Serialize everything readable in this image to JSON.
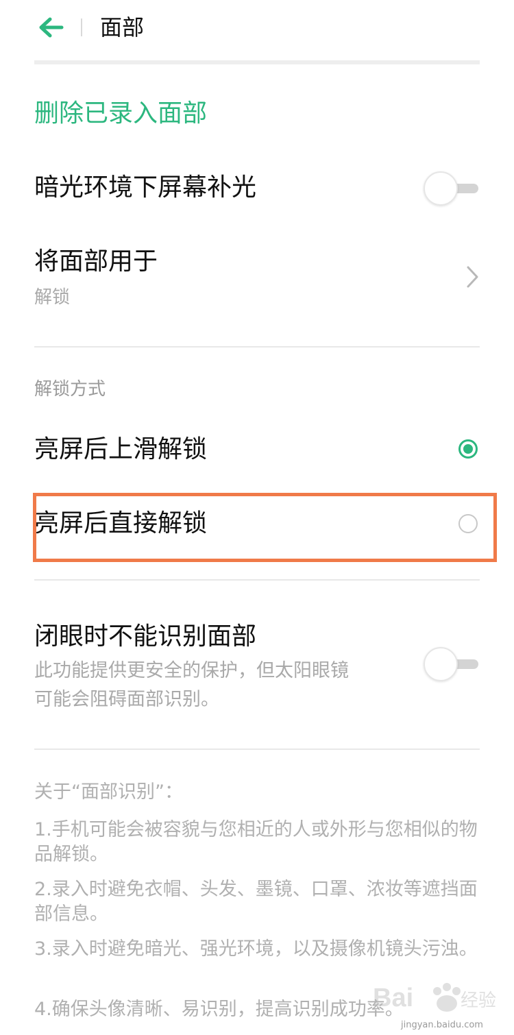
{
  "header": {
    "title": "面部",
    "back_icon": "back-arrow-icon"
  },
  "colors": {
    "accent": "#2cb77f",
    "highlight": "#f07a49"
  },
  "items": {
    "delete_face": "删除已录入面部",
    "low_light": {
      "label": "暗光环境下屏幕补光",
      "enabled": false
    },
    "use_face_for": {
      "label": "将面部用于",
      "value": "解锁"
    }
  },
  "unlock": {
    "section_title": "解锁方式",
    "options": [
      {
        "label": "亮屏后上滑解锁",
        "selected": true
      },
      {
        "label": "亮屏后直接解锁",
        "selected": false
      }
    ]
  },
  "eyes_closed": {
    "label": "闭眼时不能识别面部",
    "desc_line1": "此功能提供更安全的保护，但太阳眼镜",
    "desc_line2": "可能会阻碍面部识别。",
    "enabled": false
  },
  "about": {
    "title": "关于“面部识别”：",
    "items": [
      "1.手机可能会被容貌与您相近的人或外形与您相似的物品解锁。",
      "2.录入时避免衣帽、头发、墨镜、口罩、浓妆等遮挡面部信息。",
      "3.录入时避免暗光、强光环境，以及摄像机镜头污浊。",
      "4.确保头像清晰、易识别，提高识别成功率。"
    ]
  },
  "watermark": {
    "logo": "Bai 经验",
    "url": "jingyan.baidu.com"
  }
}
